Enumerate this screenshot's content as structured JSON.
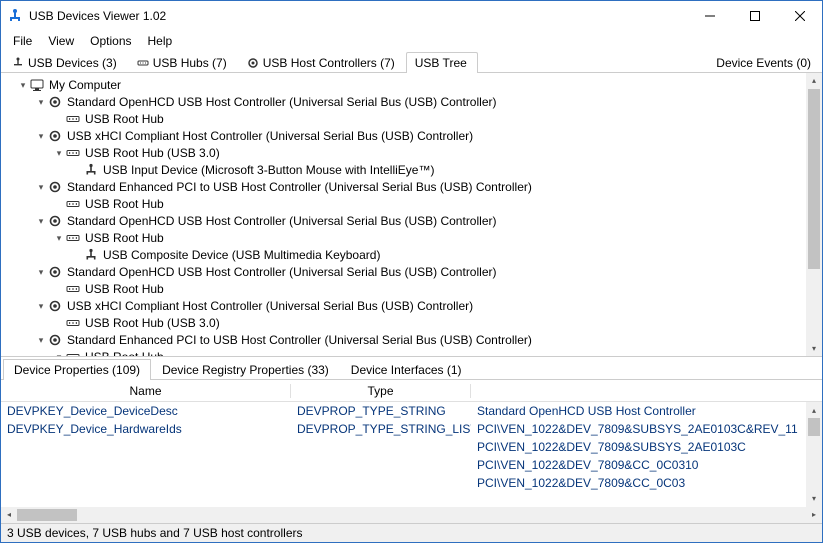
{
  "window": {
    "title": "USB Devices Viewer 1.02"
  },
  "menu": {
    "file": "File",
    "view": "View",
    "options": "Options",
    "help": "Help"
  },
  "top_tabs": {
    "devices": "USB Devices (3)",
    "hubs": "USB Hubs (7)",
    "controllers": "USB Host Controllers (7)",
    "tree": "USB Tree",
    "events": "Device Events (0)"
  },
  "tree": [
    {
      "depth": 0,
      "expander": "▾",
      "icon": "computer",
      "label": "My Computer"
    },
    {
      "depth": 1,
      "expander": "▾",
      "icon": "gear",
      "label": "Standard OpenHCD USB Host Controller (Universal Serial Bus (USB) Controller)"
    },
    {
      "depth": 2,
      "expander": "",
      "icon": "hub",
      "label": "USB Root Hub"
    },
    {
      "depth": 1,
      "expander": "▾",
      "icon": "gear",
      "label": "USB xHCI Compliant Host Controller (Universal Serial Bus (USB) Controller)"
    },
    {
      "depth": 2,
      "expander": "▾",
      "icon": "hub",
      "label": "USB Root Hub (USB 3.0)"
    },
    {
      "depth": 3,
      "expander": "",
      "icon": "usb",
      "label": "USB Input Device (Microsoft 3-Button Mouse with IntelliEye™)"
    },
    {
      "depth": 1,
      "expander": "▾",
      "icon": "gear",
      "label": "Standard Enhanced PCI to USB Host Controller (Universal Serial Bus (USB) Controller)"
    },
    {
      "depth": 2,
      "expander": "",
      "icon": "hub",
      "label": "USB Root Hub"
    },
    {
      "depth": 1,
      "expander": "▾",
      "icon": "gear",
      "label": "Standard OpenHCD USB Host Controller (Universal Serial Bus (USB) Controller)"
    },
    {
      "depth": 2,
      "expander": "▾",
      "icon": "hub",
      "label": "USB Root Hub"
    },
    {
      "depth": 3,
      "expander": "",
      "icon": "usb",
      "label": "USB Composite Device (USB Multimedia Keyboard)"
    },
    {
      "depth": 1,
      "expander": "▾",
      "icon": "gear",
      "label": "Standard OpenHCD USB Host Controller (Universal Serial Bus (USB) Controller)"
    },
    {
      "depth": 2,
      "expander": "",
      "icon": "hub",
      "label": "USB Root Hub"
    },
    {
      "depth": 1,
      "expander": "▾",
      "icon": "gear",
      "label": "USB xHCI Compliant Host Controller (Universal Serial Bus (USB) Controller)"
    },
    {
      "depth": 2,
      "expander": "",
      "icon": "hub",
      "label": "USB Root Hub (USB 3.0)"
    },
    {
      "depth": 1,
      "expander": "▾",
      "icon": "gear",
      "label": "Standard Enhanced PCI to USB Host Controller (Universal Serial Bus (USB) Controller)"
    },
    {
      "depth": 2,
      "expander": "▾",
      "icon": "hub",
      "label": "USB Root Hub"
    }
  ],
  "lower_tabs": {
    "props": "Device Properties (109)",
    "registry": "Device Registry Properties (33)",
    "interfaces": "Device Interfaces (1)"
  },
  "prop_headers": {
    "name": "Name",
    "type": "Type"
  },
  "prop_rows": [
    {
      "name": "DEVPKEY_Device_DeviceDesc",
      "type": "DEVPROP_TYPE_STRING",
      "value": "Standard OpenHCD USB Host Controller"
    },
    {
      "name": "DEVPKEY_Device_HardwareIds",
      "type": "DEVPROP_TYPE_STRING_LIST",
      "value": "PCI\\VEN_1022&DEV_7809&SUBSYS_2AE0103C&REV_11"
    },
    {
      "name": "",
      "type": "",
      "value": "PCI\\VEN_1022&DEV_7809&SUBSYS_2AE0103C"
    },
    {
      "name": "",
      "type": "",
      "value": "PCI\\VEN_1022&DEV_7809&CC_0C0310"
    },
    {
      "name": "",
      "type": "",
      "value": "PCI\\VEN_1022&DEV_7809&CC_0C03"
    }
  ],
  "status": "3 USB devices, 7 USB hubs and 7 USB host controllers"
}
